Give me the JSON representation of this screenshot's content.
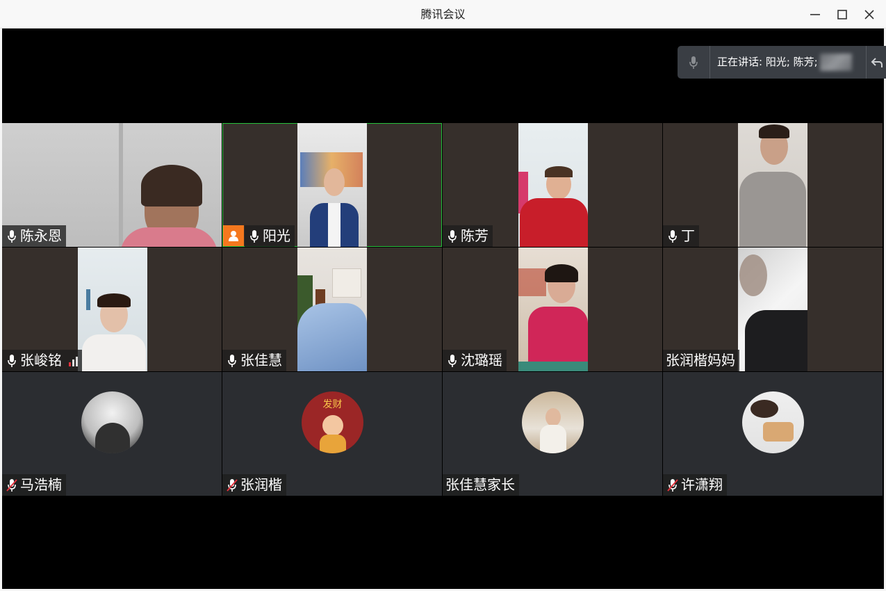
{
  "window": {
    "title": "腾讯会议"
  },
  "speaking": {
    "label": "正在讲话: ",
    "names": "阳光; 陈芳;"
  },
  "participants": [
    {
      "name": "陈永恩",
      "mic": "on"
    },
    {
      "name": "阳光",
      "mic": "on",
      "host": true,
      "active": true
    },
    {
      "name": "陈芳",
      "mic": "on"
    },
    {
      "name": "丁",
      "mic": "on"
    },
    {
      "name": "张峻铭",
      "mic": "on",
      "signal": true
    },
    {
      "name": "张佳慧",
      "mic": "on"
    },
    {
      "name": "沈璐瑶",
      "mic": "on"
    },
    {
      "name": "张润楷妈妈",
      "mic": "none"
    },
    {
      "name": "马浩楠",
      "mic": "muted"
    },
    {
      "name": "张润楷",
      "mic": "muted",
      "avatar_text": "发财"
    },
    {
      "name": "张佳慧家长",
      "mic": "none"
    },
    {
      "name": "许潇翔",
      "mic": "muted"
    }
  ],
  "colors": {
    "active_border": "#27c13c",
    "host_badge": "#f5781e",
    "muted": "#e0323c",
    "signal": "#e0323c"
  },
  "icons": [
    "minimize-icon",
    "maximize-icon",
    "close-icon",
    "microphone-icon",
    "microphone-muted-icon",
    "host-icon",
    "signal-icon",
    "return-icon"
  ]
}
